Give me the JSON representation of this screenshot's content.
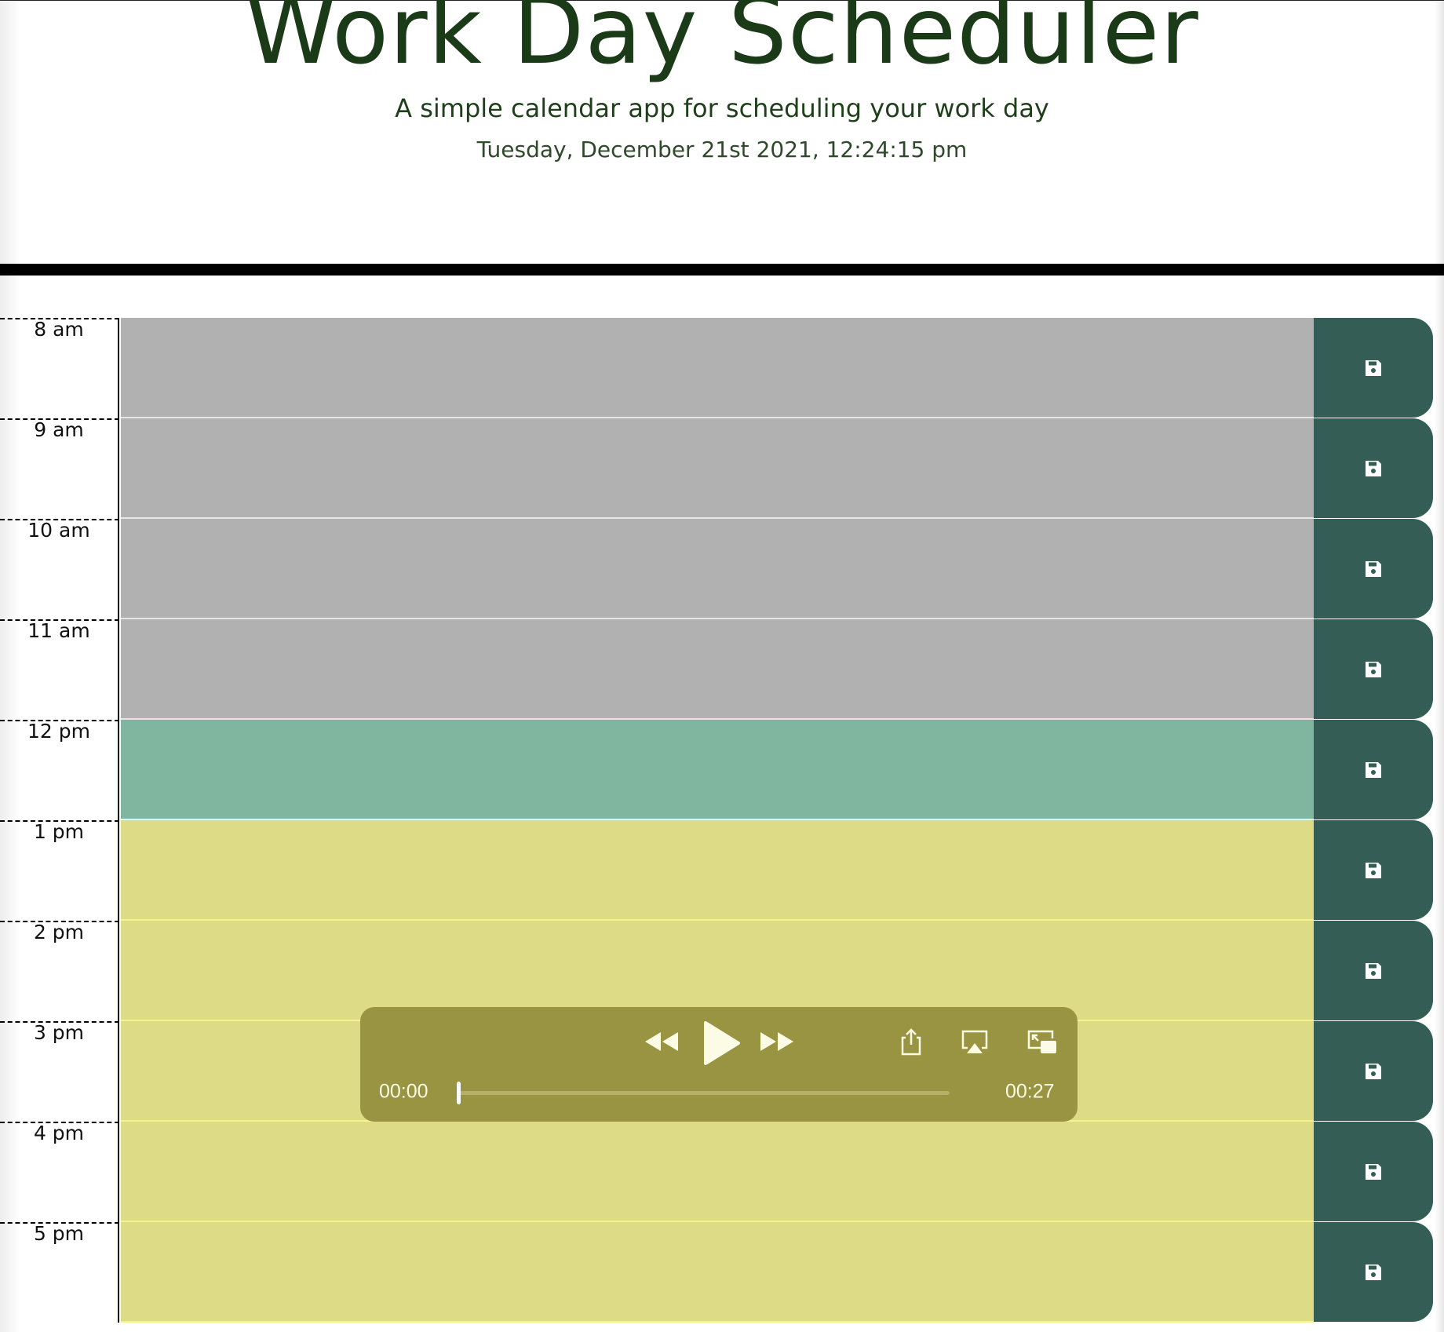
{
  "header": {
    "title": "Work Day Scheduler",
    "subtitle": "A simple calendar app for scheduling your work day",
    "current_datetime": "Tuesday, December 21st 2021, 12:24:15 pm"
  },
  "schedule": {
    "rows": [
      {
        "hour": "8 am",
        "state": "past",
        "text": ""
      },
      {
        "hour": "9 am",
        "state": "past",
        "text": ""
      },
      {
        "hour": "10 am",
        "state": "past",
        "text": ""
      },
      {
        "hour": "11 am",
        "state": "past",
        "text": ""
      },
      {
        "hour": "12 pm",
        "state": "present",
        "text": ""
      },
      {
        "hour": "1 pm",
        "state": "future",
        "text": ""
      },
      {
        "hour": "2 pm",
        "state": "future",
        "text": ""
      },
      {
        "hour": "3 pm",
        "state": "future",
        "text": ""
      },
      {
        "hour": "4 pm",
        "state": "future",
        "text": ""
      },
      {
        "hour": "5 pm",
        "state": "future",
        "text": ""
      }
    ],
    "save_icon": "floppy-disk-icon"
  },
  "colors": {
    "title": "#1b3a17",
    "past": "#b1b1b1",
    "present": "#80b6a0",
    "future": "#dddb86",
    "save_button": "#345e55",
    "player_bg": "#989441"
  },
  "media_player": {
    "current_time": "00:00",
    "duration": "00:27",
    "progress_fraction": 0,
    "icons": [
      "rewind-icon",
      "play-icon",
      "fast-forward-icon",
      "share-icon",
      "airplay-icon",
      "picture-in-picture-icon"
    ]
  }
}
